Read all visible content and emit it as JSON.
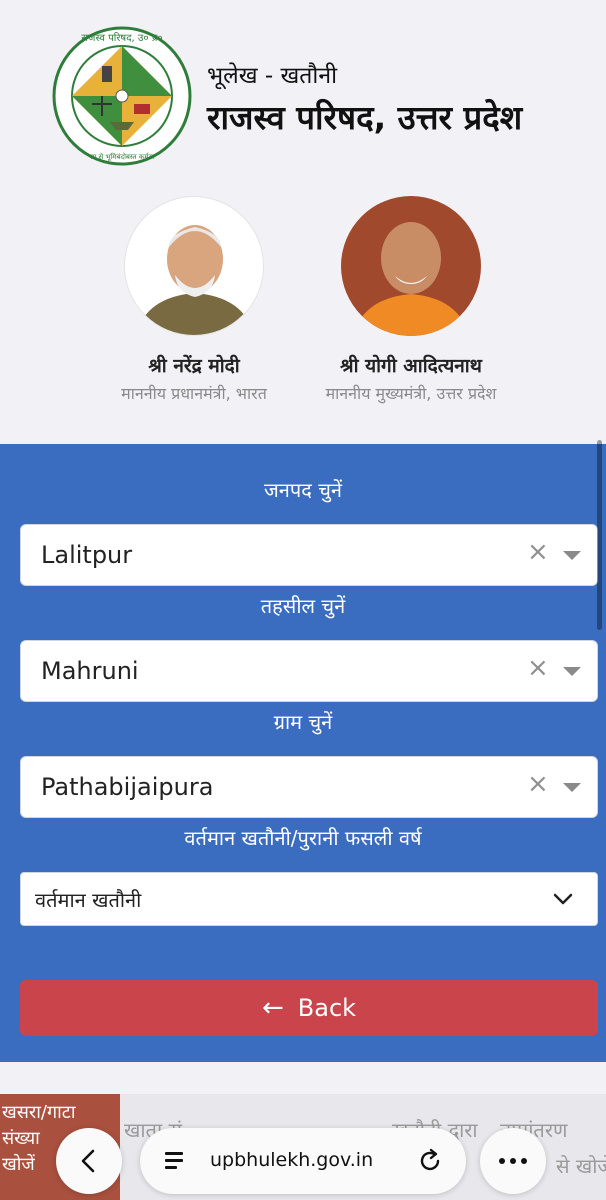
{
  "header": {
    "title_small": "भूलेख - खतौनी",
    "title_big": "राजस्व परिषद, उत्तर प्रदेश",
    "logo": {
      "ring_text_top": "राजस्व परिषद, उ० प्र०",
      "ring_text_bottom": "सा से भूमिबंदोबस्त कर्मठा",
      "icon": "board-of-revenue-emblem"
    }
  },
  "leaders": [
    {
      "name": "श्री नरेंद्र मोदी",
      "role": "माननीय प्रधानमंत्री, भारत"
    },
    {
      "name": "श्री योगी आदित्यनाथ",
      "role": "माननीय मुख्यमंत्री, उत्तर प्रदेश"
    }
  ],
  "form": {
    "district": {
      "label": "जनपद चुनें",
      "value": "Lalitpur"
    },
    "tehsil": {
      "label": "तहसील चुनें",
      "value": "Mahruni"
    },
    "village": {
      "label": "ग्राम चुनें",
      "value": "Pathabijaipura"
    },
    "year": {
      "label": "वर्तमान खतौनी/पुरानी फसली वर्ष",
      "value": "वर्तमान खतौनी"
    },
    "clear_symbol": "×",
    "back_button": {
      "arrow": "←",
      "label": "Back"
    }
  },
  "bottom_tabs": {
    "active_line1": "खसरा/गाटा",
    "active_line2": "संख्या",
    "active_line3": "खोजें",
    "tab2": "खाता सं",
    "tab3": "खतौनी द्वारा",
    "tab4": "नामांतरण",
    "tab5": "से खोजें"
  },
  "browser": {
    "url": "upbhulekh.gov.in"
  },
  "colors": {
    "panel": "#3a6cc0",
    "back_button": "#c9444b",
    "active_tab": "#a9503e"
  }
}
